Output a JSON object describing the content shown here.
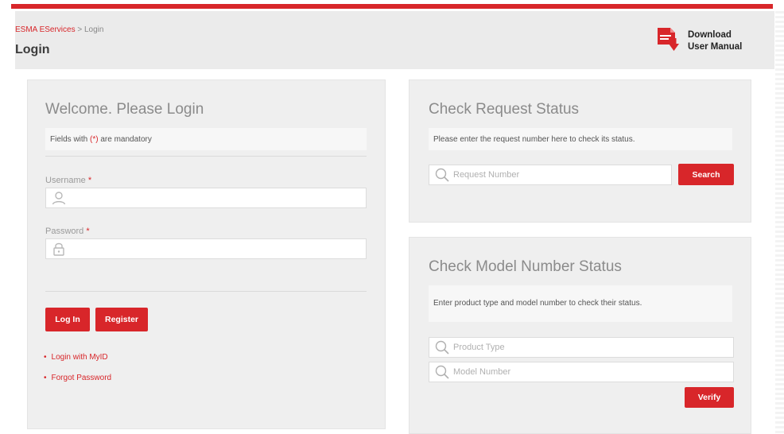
{
  "header": {
    "breadcrumb_home": "ESMA EServices",
    "breadcrumb_sep": " > ",
    "breadcrumb_current": "Login",
    "title": "Login",
    "download_line1": "Download",
    "download_line2": "User Manual"
  },
  "login": {
    "title": "Welcome. Please Login",
    "mandatory_prefix": "Fields with ",
    "mandatory_mark": "(*)",
    "mandatory_suffix": " are mandatory",
    "username_label": "Username",
    "password_label": "Password",
    "required_star": "*",
    "login_button": "Log In",
    "register_button": "Register",
    "link_myid": "Login with MyID",
    "link_forgot": "Forgot Password",
    "bullet": "•"
  },
  "request_status": {
    "title": "Check Request Status",
    "note": "Please enter the request number here to check its status.",
    "placeholder": "Request Number",
    "search_button": "Search"
  },
  "model_status": {
    "title": "Check Model Number Status",
    "note": "Enter product type and model number to check their status.",
    "product_placeholder": "Product Type",
    "model_placeholder": "Model Number",
    "verify_button": "Verify"
  },
  "colors": {
    "accent": "#d8262a",
    "panel": "#efefef",
    "header": "#ebebeb"
  },
  "icons": [
    "file-pdf-icon",
    "user-icon",
    "lock-icon",
    "search-icon"
  ]
}
